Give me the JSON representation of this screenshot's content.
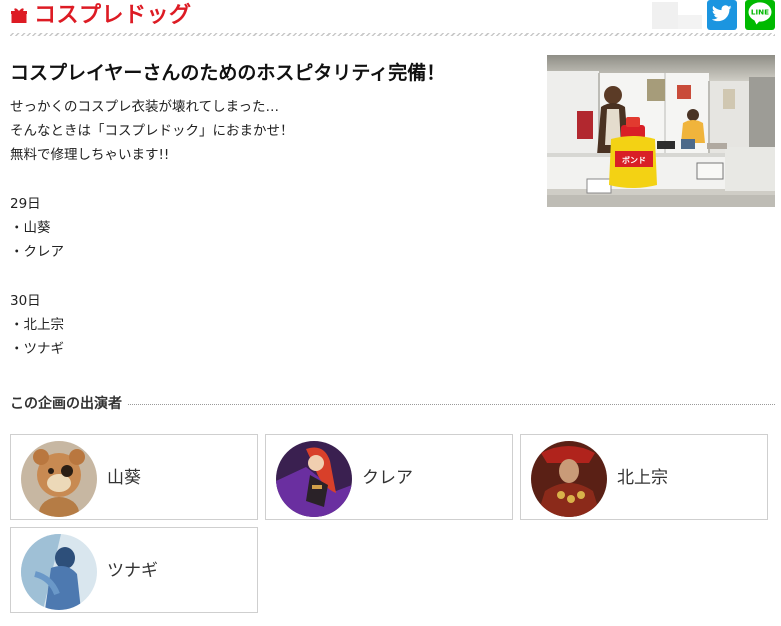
{
  "header": {
    "site_title": "コスプレドッグ",
    "brand_color": "#dd1b24",
    "brand_icon": "gift-icon",
    "share": {
      "twitter": {
        "icon": "twitter-bird-icon",
        "color": "#1b95e0"
      },
      "line": {
        "icon": "line-logo-icon",
        "label": "LINE",
        "color": "#00b900"
      }
    }
  },
  "article": {
    "title": "コスプレイヤーさんのためのホスピタリティ完備！",
    "lines": [
      "せっかくのコスプレ衣装が壊れてしまった…",
      "そんなときは「コスプレドック」におまかせ！",
      "無料で修理しちゃいます!!",
      "",
      "29日",
      "・山葵",
      "・クレア",
      "",
      "30日",
      "・北上宗",
      "・ツナギ"
    ],
    "photo": {
      "sign_text": "ボンド"
    }
  },
  "performers": {
    "section_title": "この企画の出演者",
    "items": [
      {
        "name": "山葵"
      },
      {
        "name": "クレア"
      },
      {
        "name": "北上宗"
      },
      {
        "name": "ツナギ"
      }
    ]
  }
}
